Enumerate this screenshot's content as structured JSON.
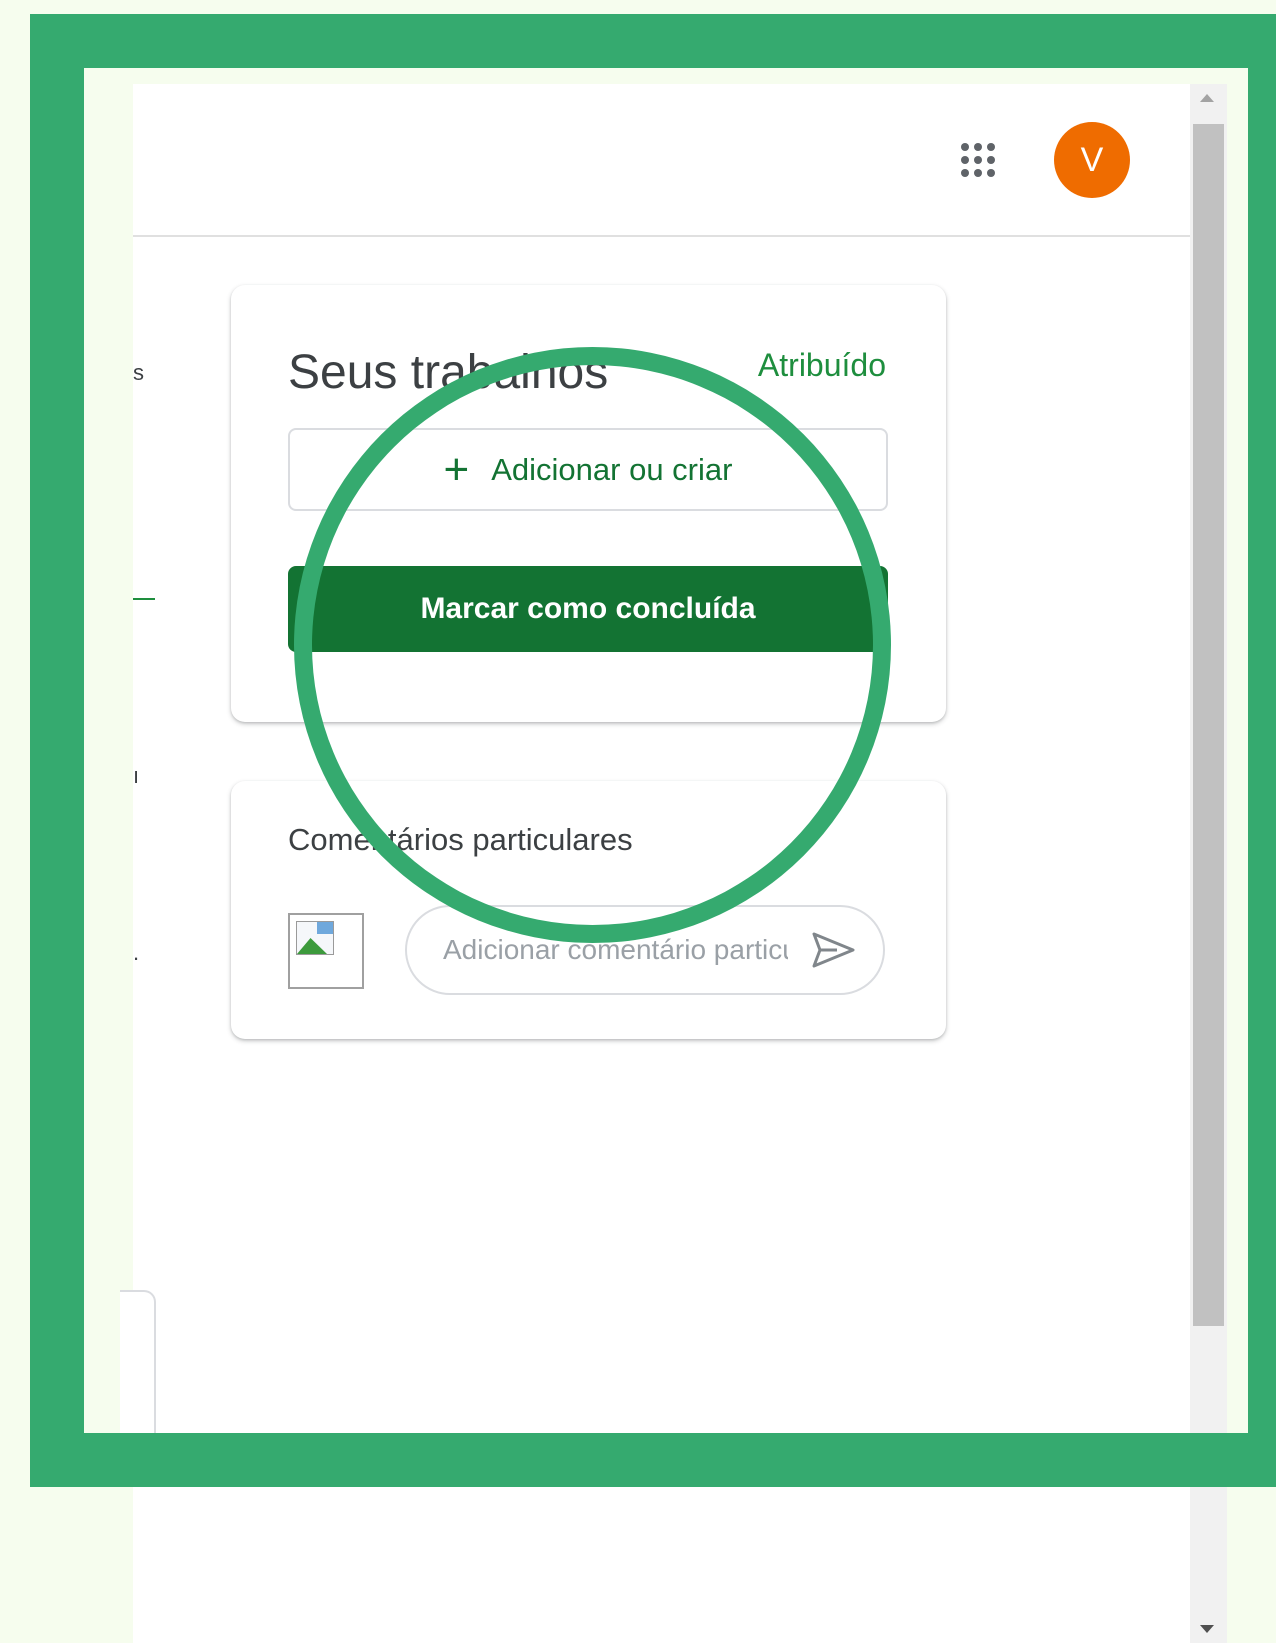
{
  "header": {
    "apps_icon": "apps-grid-icon",
    "avatar_letter": "V",
    "avatar_color": "#ef6c00"
  },
  "left_edge": {
    "fragment_1": "s",
    "fragment_2": "ı",
    "fragment_3": "."
  },
  "work_card": {
    "title": "Seus trabalhos",
    "status": "Atribuído",
    "add_icon": "plus-icon",
    "add_label": "Adicionar ou criar",
    "done_label": "Marcar como concluída"
  },
  "comments_card": {
    "title": "Comentários particulares",
    "input_placeholder": "Adicionar comentário particular...",
    "send_icon": "send-icon",
    "photo_icon": "broken-image-icon"
  },
  "colors": {
    "accent_green": "#1e8e3e",
    "button_green": "#137333",
    "frame_green": "#35aa6f",
    "background": "#f6fdee"
  }
}
